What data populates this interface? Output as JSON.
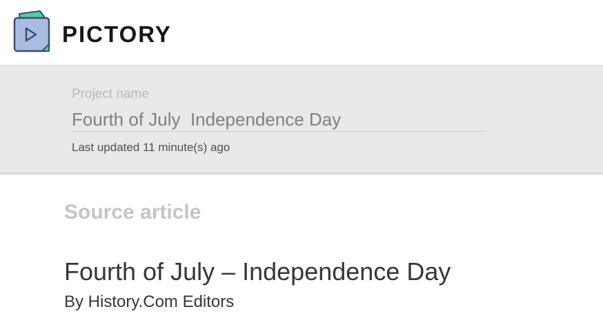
{
  "brand": {
    "name": "PICTORY",
    "logo_icon": "book-play-icon",
    "colors": {
      "logo_fill": "#a9bde0",
      "logo_stroke": "#3a4a7a",
      "logo_accent": "#4fd19a"
    }
  },
  "project": {
    "label": "Project name",
    "name_value": "Fourth of July  Independence Day",
    "last_updated": "Last updated 11 minute(s) ago"
  },
  "source": {
    "heading": "Source article",
    "article_title": "Fourth of July – Independence Day",
    "article_author": "By History.Com Editors"
  }
}
